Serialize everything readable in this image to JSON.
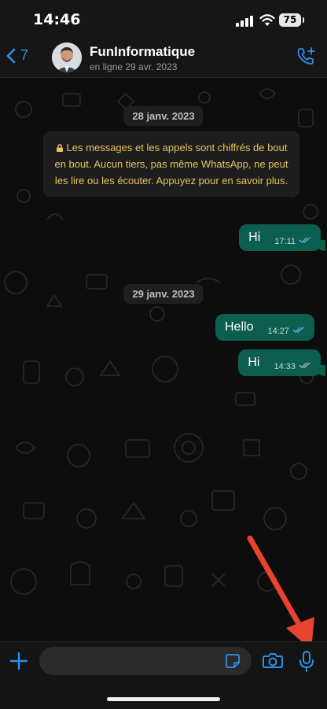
{
  "status_bar": {
    "time": "14:46",
    "battery": "75"
  },
  "header": {
    "back_count": "7",
    "name": "FunInformatique",
    "status": "en ligne 29 avr. 2023"
  },
  "chat": {
    "date1": "28 janv. 2023",
    "encryption_note": "Les messages et les appels sont chiffrés de bout en bout. Aucun tiers, pas même WhatsApp, ne peut les lire ou les écouter. Appuyez pour en savoir plus.",
    "date2": "29 janv. 2023",
    "messages": [
      {
        "text": "Hi",
        "time": "17:11"
      },
      {
        "text": "Hello",
        "time": "14:27"
      },
      {
        "text": "Hi",
        "time": "14:33"
      }
    ]
  },
  "colors": {
    "accent": "#2f8fe6",
    "bubble_out": "#0c5e4e",
    "note_text": "#e8c15b",
    "annotation_arrow": "#e8432f"
  }
}
